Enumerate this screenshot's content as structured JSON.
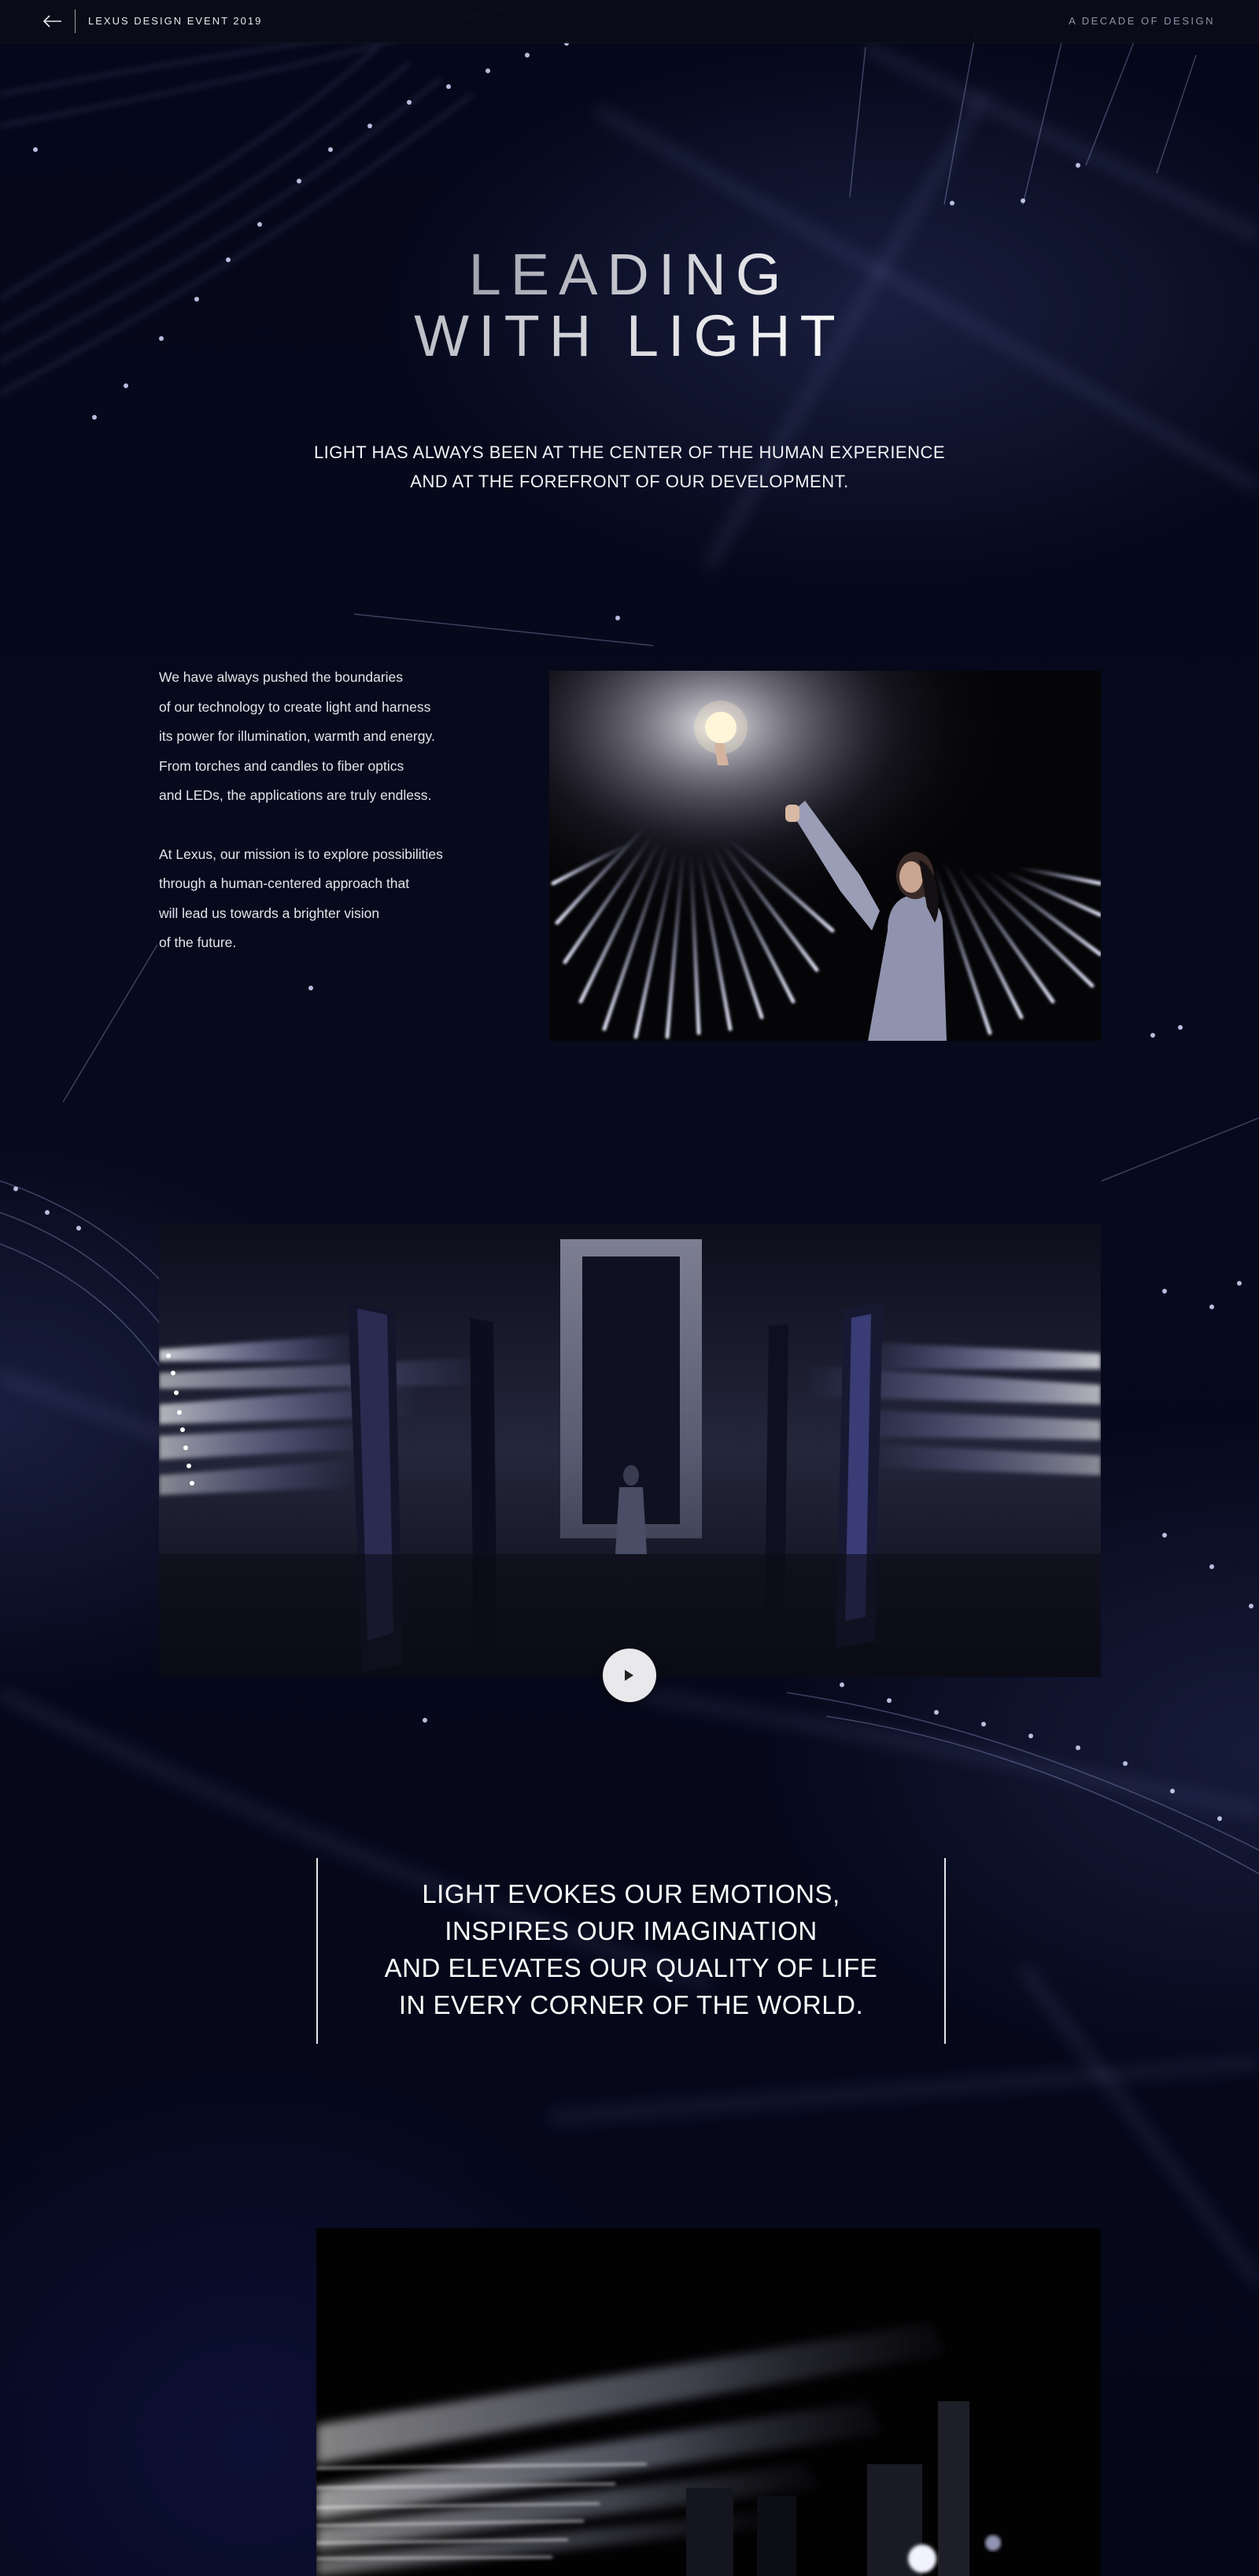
{
  "header": {
    "back_icon": "arrow-left-icon",
    "title": "LEXUS DESIGN EVENT 2019",
    "right_label": "A DECADE OF DESIGN"
  },
  "hero": {
    "title_line1": "LEADING",
    "title_line2": "WITH LIGHT",
    "subtitle_line1": "LIGHT HAS ALWAYS BEEN AT THE CENTER OF THE HUMAN EXPERIENCE",
    "subtitle_line2": "AND AT THE FOREFRONT OF OUR DEVELOPMENT."
  },
  "intro": {
    "paragraph1": "We have always pushed the boundaries\nof our technology to create light and harness\nits power for illumination, warmth and energy.\nFrom torches and candles to fiber optics\nand LEDs, the applications are truly endless.",
    "paragraph2": "At Lexus, our mission is to explore possibilities\nthrough a human-centered approach that\nwill lead us towards a brighter vision\nof the future."
  },
  "video": {
    "play_icon": "play-icon"
  },
  "quote": {
    "line1": "LIGHT EVOKES OUR EMOTIONS,",
    "line2": "INSPIRES OUR IMAGINATION",
    "line3": "AND ELEVATES OUR QUALITY OF LIFE",
    "line4": "IN EVERY CORNER OF THE WORLD."
  },
  "colors": {
    "background": "#06091a",
    "accent_light": "#aab4ff",
    "text": "#ffffff"
  }
}
